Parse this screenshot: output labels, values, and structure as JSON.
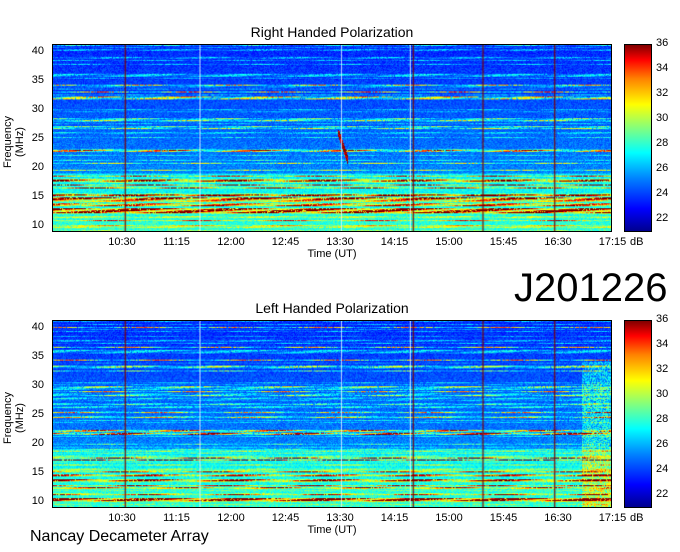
{
  "date_label": "J201226",
  "footer": "Nancay Decameter Array",
  "chart_data": [
    {
      "type": "heatmap",
      "title": "Right Handed Polarization",
      "xlabel": "Time (UT)",
      "ylabel": "Frequency (MHz)",
      "xticks": [
        "10:30",
        "11:15",
        "12:00",
        "12:45",
        "13:30",
        "14:15",
        "15:00",
        "15:45",
        "16:30",
        "17:15"
      ],
      "yticks": [
        "10",
        "15",
        "20",
        "25",
        "30",
        "35",
        "40"
      ],
      "ylim": [
        10,
        40
      ],
      "colorbar": {
        "label": "dB",
        "ticks": [
          "22",
          "24",
          "26",
          "28",
          "30",
          "32",
          "34",
          "36"
        ],
        "range": [
          21,
          36
        ]
      }
    },
    {
      "type": "heatmap",
      "title": "Left Handed Polarization",
      "xlabel": "Time (UT)",
      "ylabel": "Frequency (MHz)",
      "xticks": [
        "10:30",
        "11:15",
        "12:00",
        "12:45",
        "13:30",
        "14:15",
        "15:00",
        "15:45",
        "16:30",
        "17:15"
      ],
      "yticks": [
        "10",
        "15",
        "20",
        "25",
        "30",
        "35",
        "40"
      ],
      "ylim": [
        10,
        40
      ],
      "colorbar": {
        "label": "dB",
        "ticks": [
          "22",
          "24",
          "26",
          "28",
          "30",
          "32",
          "34",
          "36"
        ],
        "range": [
          21,
          36
        ]
      }
    }
  ]
}
